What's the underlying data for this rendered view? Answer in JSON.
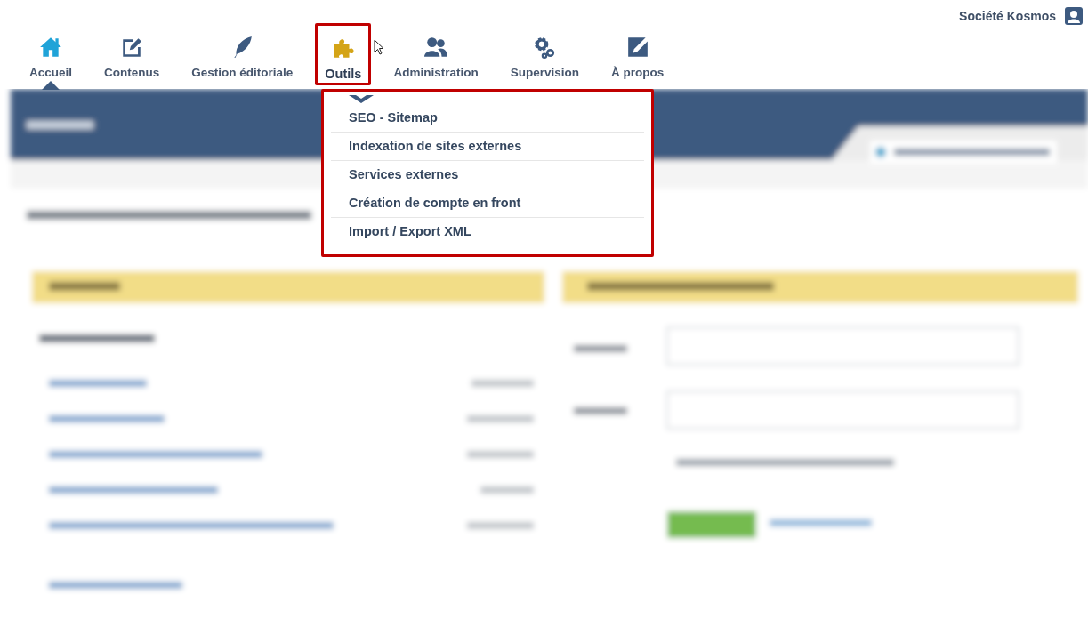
{
  "user": {
    "name": "Société Kosmos"
  },
  "nav": [
    {
      "label": "Accueil",
      "kind": "home",
      "selected": true,
      "highlighted": false
    },
    {
      "label": "Contenus",
      "kind": "edit",
      "selected": false,
      "highlighted": false
    },
    {
      "label": "Gestion éditoriale",
      "kind": "feather",
      "selected": false,
      "highlighted": false
    },
    {
      "label": "Outils",
      "kind": "puzzle",
      "selected": false,
      "highlighted": true
    },
    {
      "label": "Administration",
      "kind": "users",
      "selected": false,
      "highlighted": false
    },
    {
      "label": "Supervision",
      "kind": "gears",
      "selected": false,
      "highlighted": false
    },
    {
      "label": "À propos",
      "kind": "pen",
      "selected": false,
      "highlighted": false
    }
  ],
  "menu": {
    "highlighted": true,
    "items": [
      "SEO - Sitemap",
      "Indexation de sites externes",
      "Services externes",
      "Création de compte en front",
      "Import / Export XML"
    ]
  }
}
